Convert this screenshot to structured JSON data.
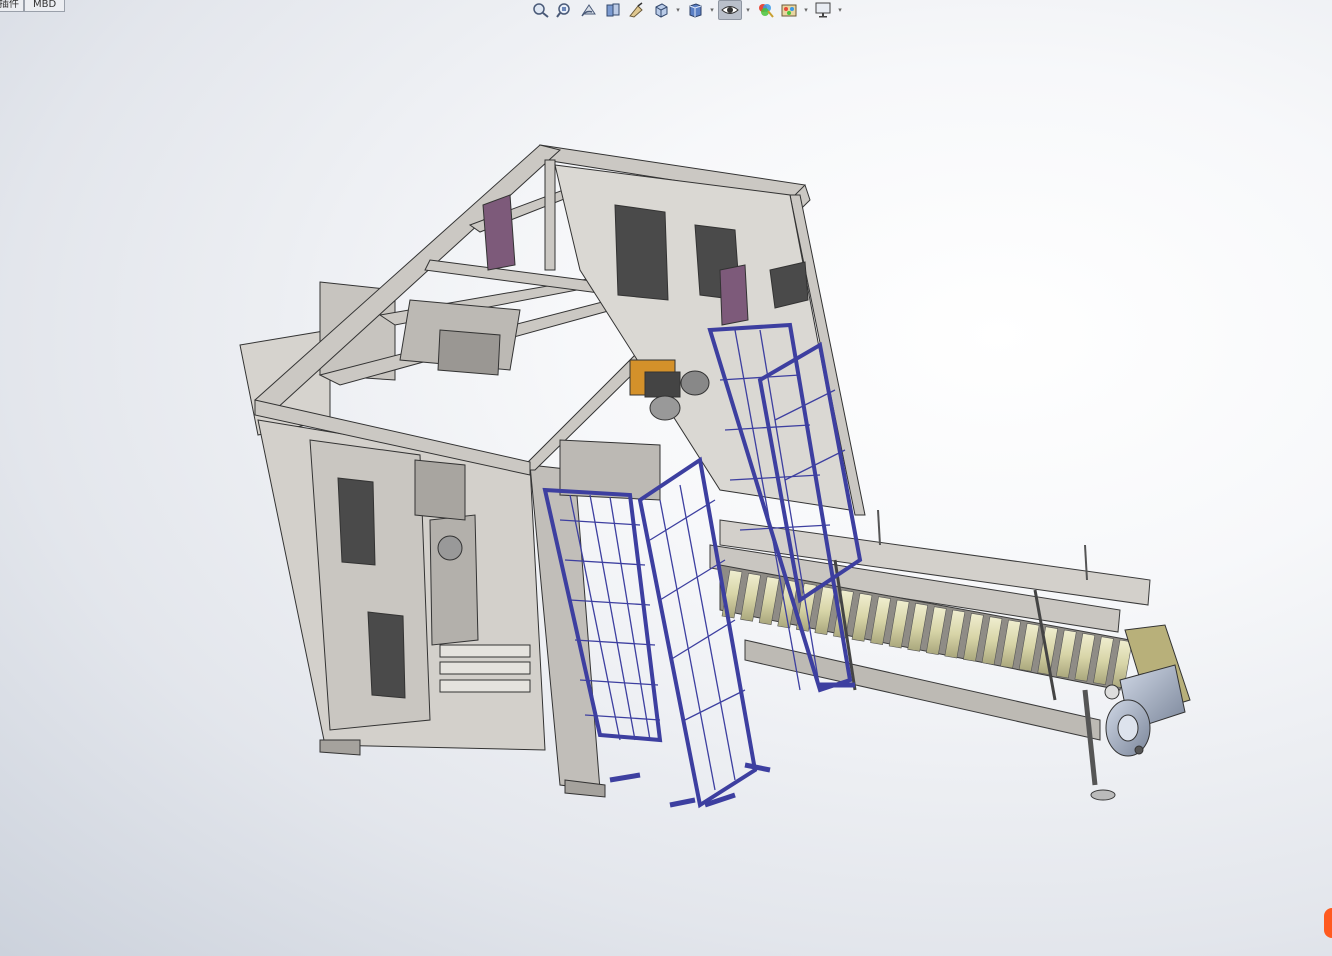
{
  "command_manager": {
    "tabs": [
      {
        "label": "插件"
      },
      {
        "label": "MBD"
      }
    ]
  },
  "heads_up_toolbar": {
    "tools": [
      {
        "name": "zoom-to-fit",
        "icon": "zoom-fit-icon"
      },
      {
        "name": "zoom-to-area",
        "icon": "zoom-area-icon"
      },
      {
        "name": "previous-view",
        "icon": "previous-view-icon"
      },
      {
        "name": "section-view",
        "icon": "section-view-icon"
      },
      {
        "name": "dynamic-annotation-views",
        "icon": "annotation-view-icon"
      },
      {
        "name": "view-orientation",
        "icon": "view-orientation-icon",
        "dropdown": true
      },
      {
        "name": "display-style",
        "icon": "display-style-icon",
        "dropdown": true
      },
      {
        "name": "hide-show-items",
        "icon": "eye-icon",
        "dropdown": true,
        "active": true
      },
      {
        "name": "edit-appearance",
        "icon": "edit-appearance-icon"
      },
      {
        "name": "apply-scene",
        "icon": "scene-icon",
        "dropdown": true
      },
      {
        "name": "view-settings",
        "icon": "monitor-icon",
        "dropdown": true
      }
    ]
  },
  "graphics_area": {
    "content": "3D assembly model of a packing machine with roller conveyor",
    "colors": {
      "frame": "#c9c6c1",
      "frame_edge": "#3a3a3a",
      "guard": "#3d3fa0",
      "rollers": "#dcd9b0",
      "motor": "#a8b4c8",
      "panel": "#4a4a4a",
      "accent_purple": "#7d5a7a",
      "motor_plate": "#b8b07a",
      "orange_part": "#d4912a"
    }
  }
}
